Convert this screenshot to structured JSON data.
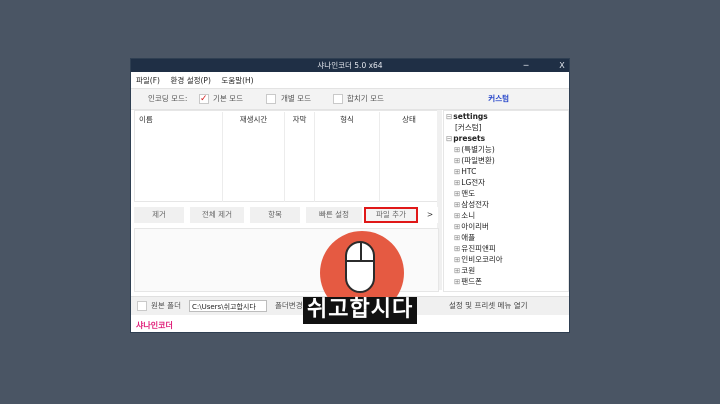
{
  "window": {
    "title": "샤나인코더 5.0 x64",
    "minimize": "─",
    "close": "X",
    "menu": [
      "파일(F)",
      "환경 설정(P)",
      "도움말(H)"
    ],
    "mode_label": "인코딩 모드:",
    "modes": [
      {
        "label": "기본 모드",
        "checked": true
      },
      {
        "label": "개별 모드",
        "checked": false
      },
      {
        "label": "합치기 모드",
        "checked": false
      }
    ],
    "custom_link": "커스텀",
    "columns": [
      "이름",
      "재생시간",
      "자막",
      "형식",
      "상태"
    ],
    "buttons": [
      "제거",
      "전체 제거",
      "항목",
      "빠른 설정",
      "파일 추가",
      ">"
    ],
    "bottom": {
      "source_folder_label": "원본 폴더",
      "path_value": "C:\\Users\\쉬고합시다",
      "change_folder": "폴더변경",
      "settings_menu": "설정 및 프리셋 메뉴 열기"
    },
    "brand": "샤나인코더",
    "tree": [
      {
        "label": "settings",
        "toggle": "⊟",
        "indent": 0,
        "bold": true
      },
      {
        "label": "[커스텀]",
        "toggle": "",
        "indent": 1,
        "bold": false
      },
      {
        "label": "presets",
        "toggle": "⊟",
        "indent": 0,
        "bold": true
      },
      {
        "label": "(특별기능)",
        "toggle": "⊞",
        "indent": 1,
        "bold": false
      },
      {
        "label": "(파일변환)",
        "toggle": "⊞",
        "indent": 1,
        "bold": false
      },
      {
        "label": "HTC",
        "toggle": "⊞",
        "indent": 1,
        "bold": false
      },
      {
        "label": "LG전자",
        "toggle": "⊞",
        "indent": 1,
        "bold": false
      },
      {
        "label": "맨도",
        "toggle": "⊞",
        "indent": 1,
        "bold": false
      },
      {
        "label": "삼성전자",
        "toggle": "⊞",
        "indent": 1,
        "bold": false
      },
      {
        "label": "소니",
        "toggle": "⊞",
        "indent": 1,
        "bold": false
      },
      {
        "label": "아이리버",
        "toggle": "⊞",
        "indent": 1,
        "bold": false
      },
      {
        "label": "애플",
        "toggle": "⊞",
        "indent": 1,
        "bold": false
      },
      {
        "label": "유진피앤피",
        "toggle": "⊞",
        "indent": 1,
        "bold": false
      },
      {
        "label": "인비오코리아",
        "toggle": "⊞",
        "indent": 1,
        "bold": false
      },
      {
        "label": "코원",
        "toggle": "⊞",
        "indent": 1,
        "bold": false
      },
      {
        "label": "팬드폰",
        "toggle": "⊞",
        "indent": 1,
        "bold": false
      }
    ]
  },
  "caption": "쉬고합시다",
  "colors": {
    "accent_red": "#e01818",
    "brand_pink": "#e0207a",
    "link_blue": "#2040c8",
    "cursor_circle": "#e55a42"
  },
  "icons": {
    "mouse": "mouse-icon"
  }
}
